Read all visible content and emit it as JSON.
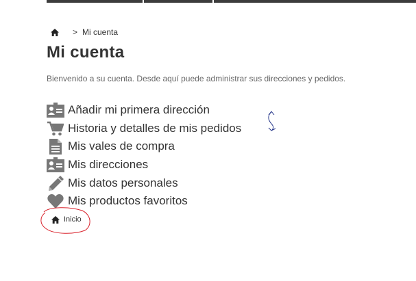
{
  "breadcrumb": {
    "separator": ">",
    "current": "Mi cuenta",
    "home_icon": "home-icon"
  },
  "page": {
    "title": "Mi cuenta",
    "welcome": "Bienvenido a su cuenta. Desde aquí puede administrar sus direcciones y pedidos."
  },
  "account_links": [
    {
      "label": "Añadir mi primera dirección",
      "icon": "address-card-icon"
    },
    {
      "label": "Historia y detalles de mis pedidos",
      "icon": "cart-icon"
    },
    {
      "label": "Mis vales de compra",
      "icon": "document-icon"
    },
    {
      "label": "Mis direcciones",
      "icon": "address-card-icon"
    },
    {
      "label": "Mis datos personales",
      "icon": "pencil-icon"
    },
    {
      "label": "Mis productos favoritos",
      "icon": "heart-icon"
    }
  ],
  "footer": {
    "home_label": "Inicio",
    "home_icon": "home-icon"
  },
  "colors": {
    "text": "#333333",
    "icon": "#777777",
    "annotation_red": "#d9202a",
    "annotation_blue": "#2a3a8c"
  }
}
